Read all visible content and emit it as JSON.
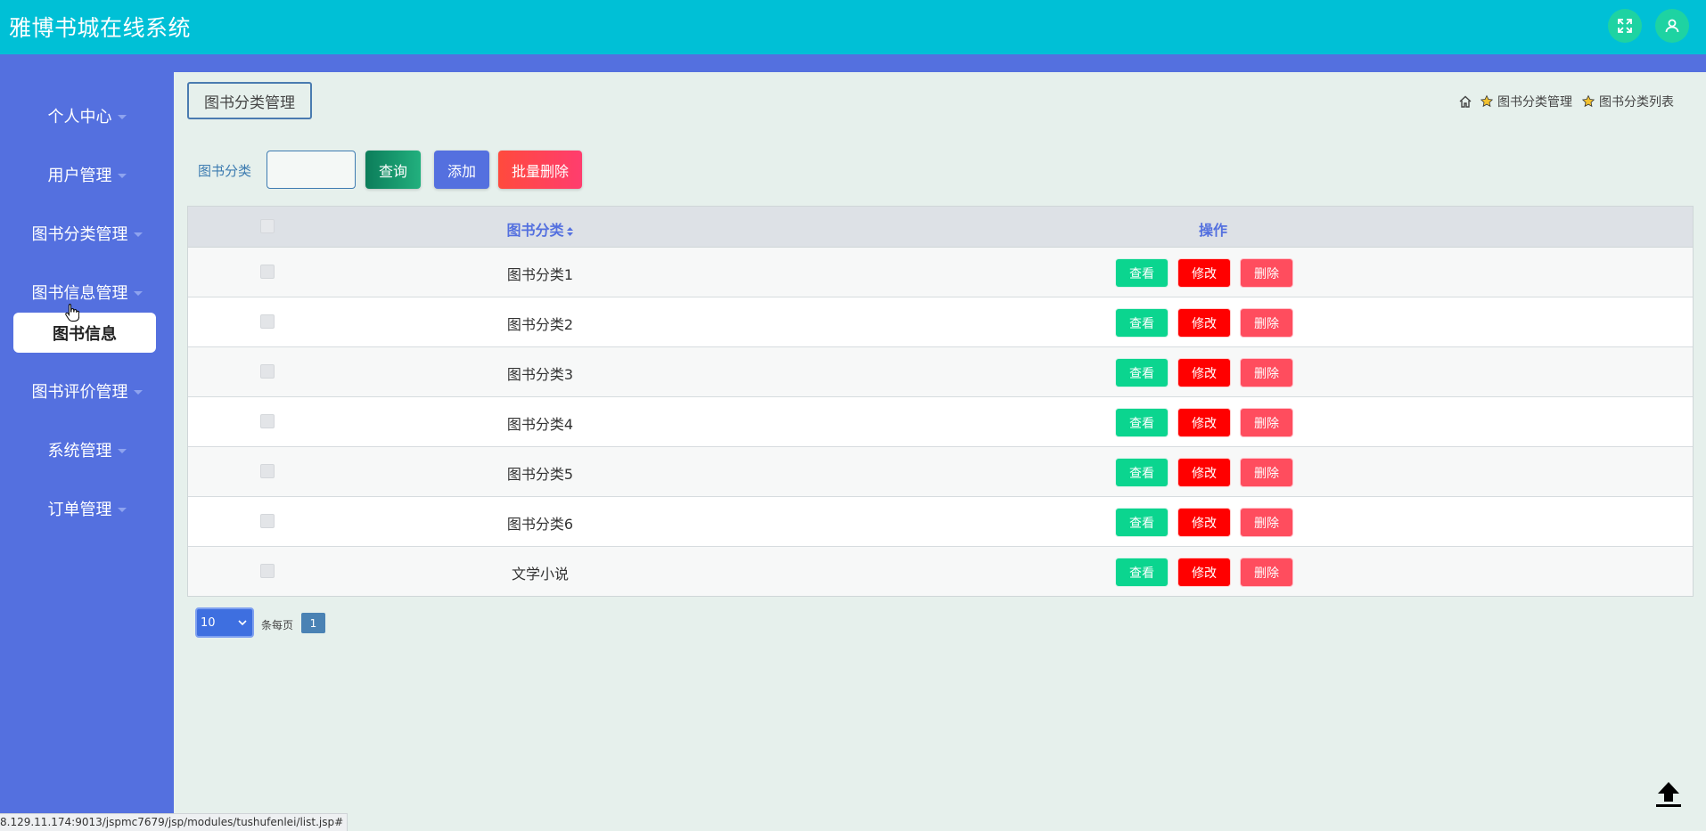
{
  "app": {
    "title": "雅博书城在线系统"
  },
  "header": {
    "fullscreen_icon": "expand-icon",
    "user_icon": "user-icon"
  },
  "sidebar": {
    "items": [
      {
        "label": "个人中心"
      },
      {
        "label": "用户管理"
      },
      {
        "label": "图书分类管理"
      },
      {
        "label": "图书信息管理"
      },
      {
        "label": "图书评价管理"
      },
      {
        "label": "系统管理"
      },
      {
        "label": "订单管理"
      }
    ],
    "submenu": {
      "label": "图书信息"
    }
  },
  "main": {
    "section_tag": "图书分类管理",
    "breadcrumb": {
      "items": [
        "图书分类管理",
        "图书分类列表"
      ]
    },
    "search": {
      "label": "图书分类",
      "value": "",
      "placeholder": ""
    },
    "toolbar": {
      "query": "查询",
      "add": "添加",
      "batch_delete": "批量删除"
    },
    "table": {
      "headers": {
        "name": "图书分类",
        "actions": "操作"
      },
      "actions": {
        "view": "查看",
        "edit": "修改",
        "delete": "删除"
      },
      "rows": [
        {
          "name": "图书分类1"
        },
        {
          "name": "图书分类2"
        },
        {
          "name": "图书分类3"
        },
        {
          "name": "图书分类4"
        },
        {
          "name": "图书分类5"
        },
        {
          "name": "图书分类6"
        },
        {
          "name": "文学小说"
        }
      ]
    },
    "pagination": {
      "page_size": "10",
      "per_page_label": "条每页",
      "current_page": "1"
    }
  },
  "status_bar": {
    "url": "8.129.11.174:9013/jspmc7679/jsp/modules/tushufenlei/list.jsp#"
  },
  "colors": {
    "header": "#00c0d6",
    "sidebar": "#5470df",
    "view": "#0bd58f",
    "edit": "#ff0000",
    "delete": "#ff4d5e"
  }
}
